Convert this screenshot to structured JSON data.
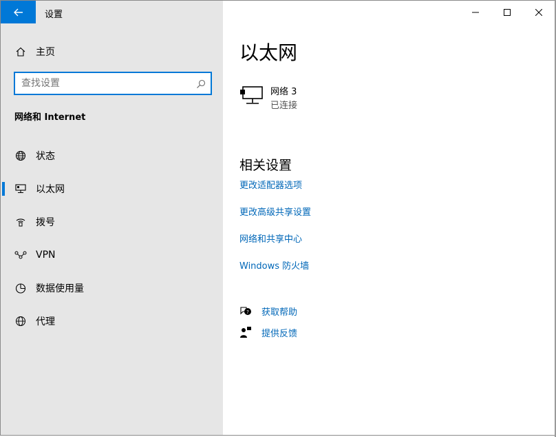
{
  "window": {
    "app_title": "设置",
    "controls": [
      "minimize",
      "maximize",
      "close"
    ]
  },
  "sidebar": {
    "home_label": "主页",
    "search": {
      "placeholder": "查找设置",
      "value": ""
    },
    "section_heading": "网络和 Internet",
    "items": [
      {
        "label": "状态",
        "icon": "status-globe-icon",
        "active": false
      },
      {
        "label": "以太网",
        "icon": "ethernet-icon",
        "active": true
      },
      {
        "label": "拨号",
        "icon": "dialup-icon",
        "active": false
      },
      {
        "label": "VPN",
        "icon": "vpn-icon",
        "active": false
      },
      {
        "label": "数据使用量",
        "icon": "data-usage-icon",
        "active": false
      },
      {
        "label": "代理",
        "icon": "proxy-globe-icon",
        "active": false
      }
    ]
  },
  "main": {
    "title": "以太网",
    "ethernet": {
      "name": "网络 3",
      "status": "已连接"
    },
    "related": {
      "heading": "相关设置",
      "links": [
        "更改适配器选项",
        "更改高级共享设置",
        "网络和共享中心",
        "Windows 防火墙"
      ]
    },
    "help": {
      "get_help": "获取帮助",
      "feedback": "提供反馈"
    }
  },
  "colors": {
    "accent": "#0078d7",
    "link": "#0067b8",
    "sidebar_bg": "#e6e6e6"
  }
}
